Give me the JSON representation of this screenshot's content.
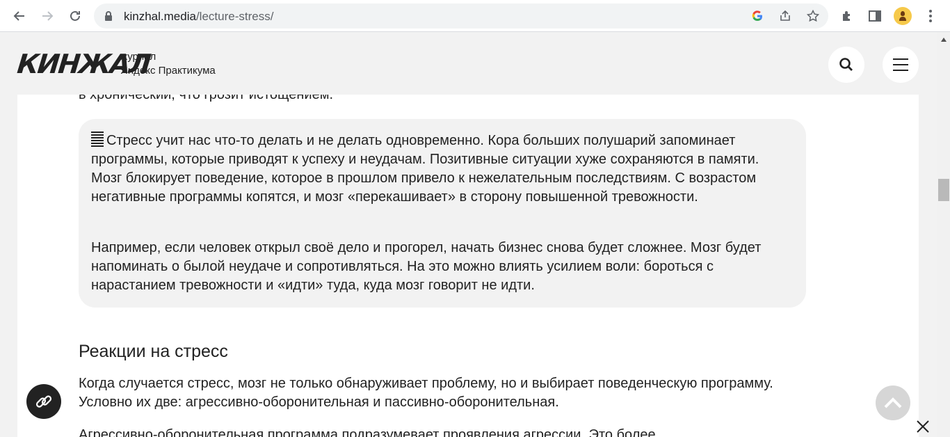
{
  "browser": {
    "url_host": "kinzhal.media",
    "url_path": "/lecture-stress/"
  },
  "header": {
    "logo": "КИНЖАЛ",
    "subtitle_line1": "журнал",
    "subtitle_line2": "Яндекс Практикума"
  },
  "article": {
    "clipped_line": "в хронический, что грозит истощением.",
    "callout": {
      "paragraph1": "Стресс учит нас что-то делать и не делать одновременно. Кора больших полушарий запоминает программы, которые приводят к успеху и неудачам. Позитивные ситуации хуже сохраняются в памяти. Мозг блокирует поведение, которое в прошлом привело к нежелательным последствиям. С возрастом негативные программы копятся, и мозг «перекашивает» в сторону повышенной тревожности.",
      "paragraph2": "Например, если человек открыл своё дело и прогорел, начать бизнес снова будет сложнее. Мозг будет напоминать о былой неудаче и сопротивляться. На это можно влиять усилием воли: бороться с нарастанием тревожности и «идти» туда, куда мозг говорит не идти."
    },
    "heading": "Реакции на стресс",
    "paragraph": "Когда случается стресс, мозг не только обнаруживает проблему, но и выбирает поведенческую программу. Условно их две: агрессивно-оборонительная и пассивно-оборонительная.",
    "paragraph_cut": "Агрессивно-оборонительная программа подразумевает проявления агрессии. Это более"
  },
  "icons": {
    "back": "back-arrow-icon",
    "forward": "forward-arrow-icon",
    "reload": "reload-icon",
    "lock": "lock-icon",
    "google": "google-icon",
    "share": "share-icon",
    "star": "star-icon",
    "extensions": "puzzle-icon",
    "sidepanel": "side-panel-icon",
    "menu": "kebab-menu-icon",
    "search": "search-icon",
    "hamburger": "hamburger-icon",
    "link": "link-icon",
    "up": "chevron-up-icon",
    "close": "close-icon"
  }
}
